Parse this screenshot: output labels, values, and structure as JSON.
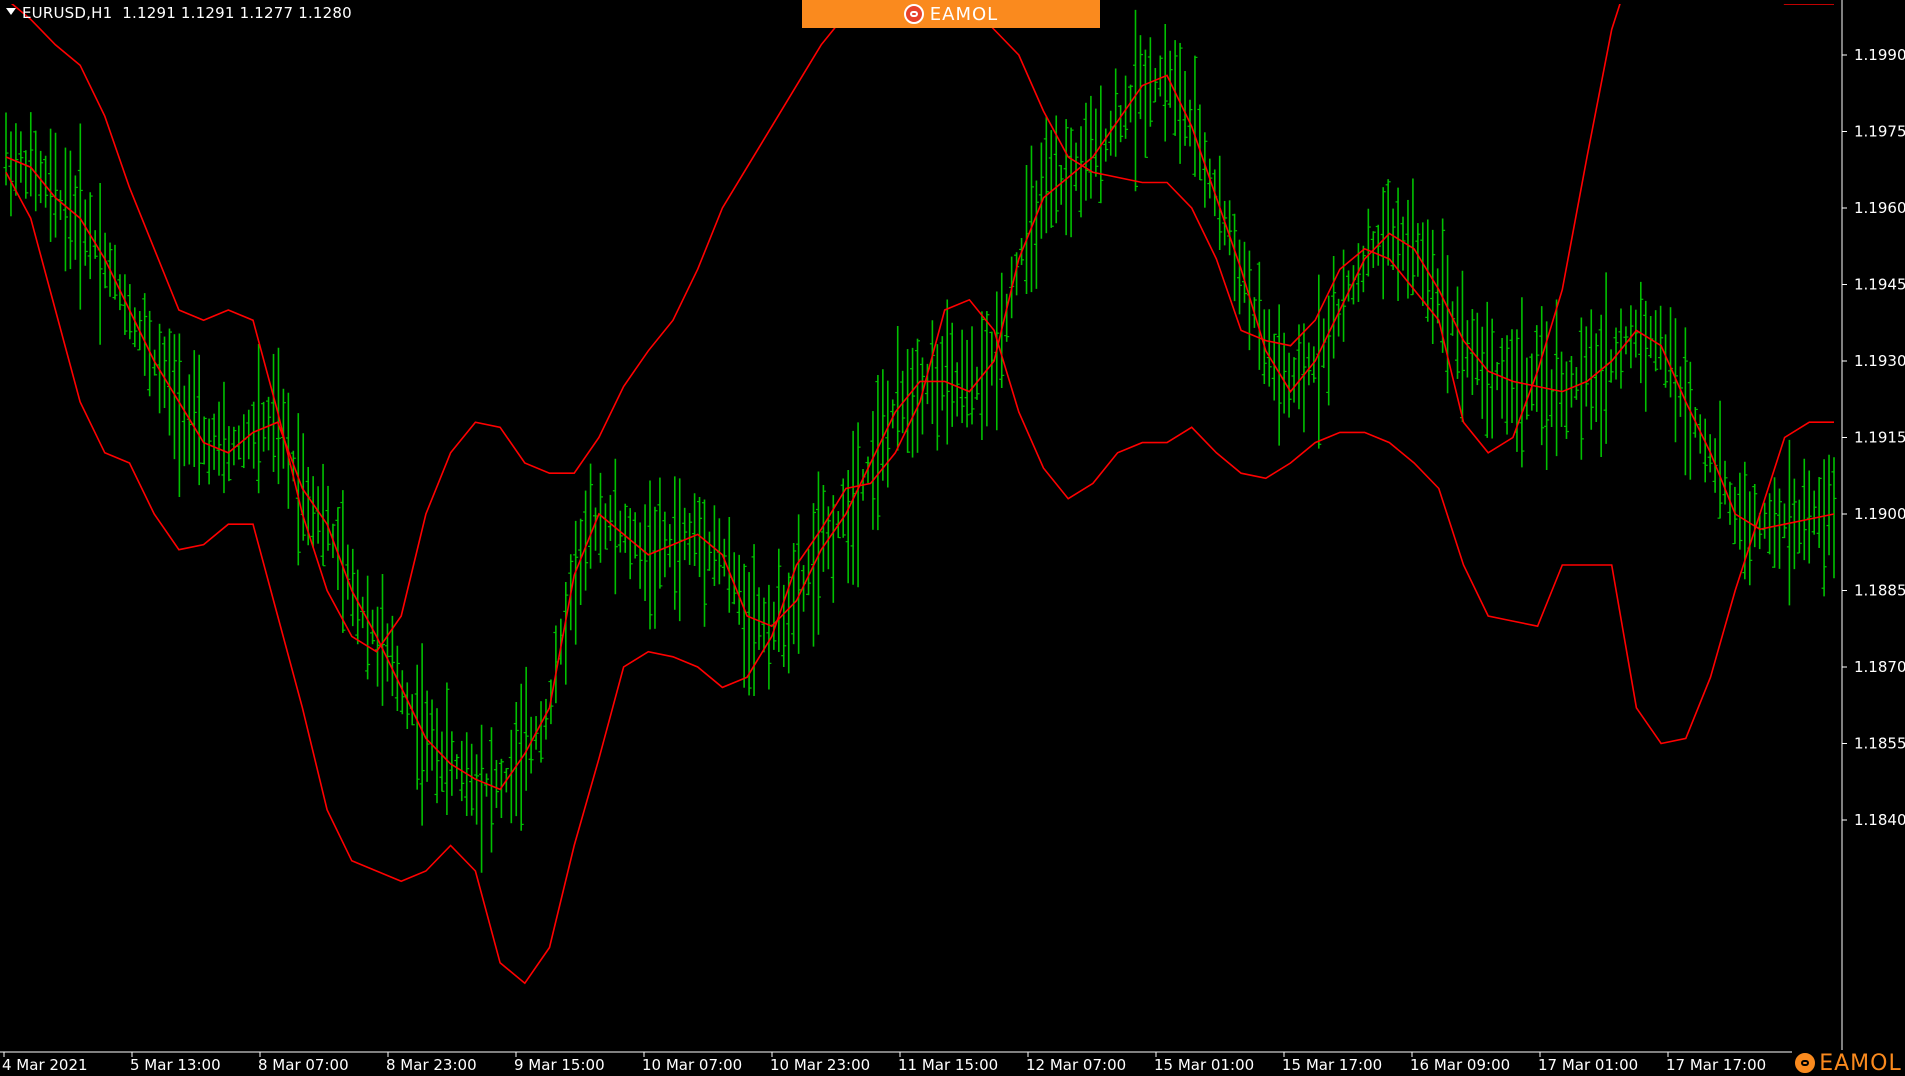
{
  "header": {
    "symbol": "EURUSD,H1",
    "ohlc": "1.1291 1.1291 1.1277 1.1280"
  },
  "branding": {
    "banner_text": "EAMOL",
    "corner_text": "EAMOL",
    "banner_color": "#fa8a1e"
  },
  "colors": {
    "background": "#000000",
    "bars": "#00c000",
    "bands": "#ff0000",
    "axis": "#ffffff",
    "text": "#ffffff"
  },
  "chart_data": {
    "type": "line",
    "title": "",
    "xlabel": "",
    "ylabel": "",
    "ylim": [
      1.1832,
      1.1999
    ],
    "grid": false,
    "y_ticks": [
      "1.1990",
      "1.1975",
      "1.1960",
      "1.1945",
      "1.1930",
      "1.1915",
      "1.1900",
      "1.1885",
      "1.1870",
      "1.1855",
      "1.1840"
    ],
    "x_ticks": [
      "4 Mar 2021",
      "5 Mar 13:00",
      "8 Mar 07:00",
      "8 Mar 23:00",
      "9 Mar 15:00",
      "10 Mar 07:00",
      "10 Mar 23:00",
      "11 Mar 15:00",
      "12 Mar 07:00",
      "15 Mar 01:00",
      "15 Mar 17:00",
      "16 Mar 09:00",
      "17 Mar 01:00",
      "17 Mar 17:00"
    ],
    "price_series": {
      "name": "",
      "tick_index": [
        0,
        5,
        10,
        15,
        20,
        25,
        30,
        35,
        40,
        45,
        50,
        55,
        60,
        65,
        70,
        75,
        80,
        85,
        90,
        95,
        100,
        105,
        110,
        115,
        120,
        125,
        130,
        135,
        140,
        145,
        150,
        155,
        160,
        165,
        170,
        175,
        180,
        185,
        190,
        195,
        200,
        205,
        210,
        215,
        220,
        225,
        230,
        235,
        240,
        245,
        250,
        255,
        260,
        265,
        270,
        275,
        280,
        285,
        290,
        295,
        300,
        305,
        310,
        315,
        320,
        325,
        330,
        335,
        340,
        345,
        350,
        355,
        360,
        365,
        370
      ],
      "values": [
        1.197,
        1.1968,
        1.1962,
        1.1958,
        1.195,
        1.194,
        1.193,
        1.1922,
        1.1914,
        1.1912,
        1.1916,
        1.1918,
        1.1905,
        1.1898,
        1.1885,
        1.1876,
        1.1866,
        1.1856,
        1.1851,
        1.1848,
        1.1846,
        1.1853,
        1.1862,
        1.1888,
        1.19,
        1.1896,
        1.1892,
        1.1894,
        1.1896,
        1.1892,
        1.188,
        1.1878,
        1.1883,
        1.1893,
        1.19,
        1.191,
        1.192,
        1.1926,
        1.1926,
        1.1924,
        1.193,
        1.195,
        1.1962,
        1.1966,
        1.197,
        1.1977,
        1.1984,
        1.1986,
        1.1976,
        1.1962,
        1.1948,
        1.1932,
        1.1924,
        1.193,
        1.194,
        1.195,
        1.1955,
        1.1952,
        1.1944,
        1.1934,
        1.1928,
        1.1926,
        1.1925,
        1.1924,
        1.1926,
        1.193,
        1.1936,
        1.1933,
        1.1922,
        1.1912,
        1.19,
        1.1897,
        1.1898,
        1.1899,
        1.19
      ]
    },
    "bands": [
      {
        "name": "",
        "values": [
          1.2001,
          1.1997,
          1.1992,
          1.1988,
          1.1978,
          1.1964,
          1.1952,
          1.194,
          1.1938,
          1.194,
          1.1938,
          1.192,
          1.19,
          1.1885,
          1.1876,
          1.1873,
          1.188,
          1.19,
          1.1912,
          1.1918,
          1.1917,
          1.191,
          1.1908,
          1.1908,
          1.1915,
          1.1925,
          1.1932,
          1.1938,
          1.1948,
          1.196,
          1.1968,
          1.1976,
          1.1984,
          1.1992,
          1.1998,
          1.2,
          1.2003,
          1.2008,
          1.2008,
          1.2,
          1.1995,
          1.199,
          1.1979,
          1.197,
          1.1967,
          1.1966,
          1.1965,
          1.1965,
          1.196,
          1.195,
          1.1936,
          1.1934,
          1.1933,
          1.1938,
          1.1948,
          1.1952,
          1.195,
          1.1944,
          1.1938,
          1.1918,
          1.1912,
          1.1915,
          1.1928,
          1.1944,
          1.197,
          1.1995,
          1.201,
          1.202,
          1.2022,
          1.2015,
          1.201,
          1.2005,
          1.2,
          1.2,
          1.2
        ]
      },
      {
        "name": "",
        "values": [
          1.1967,
          1.1958,
          1.194,
          1.1922,
          1.1912,
          1.191,
          1.19,
          1.1893,
          1.1894,
          1.1898,
          1.1898,
          1.188,
          1.1862,
          1.1842,
          1.1832,
          1.183,
          1.1828,
          1.183,
          1.1835,
          1.183,
          1.1812,
          1.1808,
          1.1815,
          1.1835,
          1.1852,
          1.187,
          1.1873,
          1.1872,
          1.187,
          1.1866,
          1.1868,
          1.1876,
          1.189,
          1.1897,
          1.1905,
          1.1906,
          1.1912,
          1.1922,
          1.194,
          1.1942,
          1.1936,
          1.192,
          1.1909,
          1.1903,
          1.1906,
          1.1912,
          1.1914,
          1.1914,
          1.1917,
          1.1912,
          1.1908,
          1.1907,
          1.191,
          1.1914,
          1.1916,
          1.1916,
          1.1914,
          1.191,
          1.1905,
          1.189,
          1.188,
          1.1879,
          1.1878,
          1.189,
          1.189,
          1.189,
          1.1862,
          1.1855,
          1.1856,
          1.1868,
          1.1885,
          1.19,
          1.1915,
          1.1918,
          1.1918
        ]
      }
    ]
  }
}
